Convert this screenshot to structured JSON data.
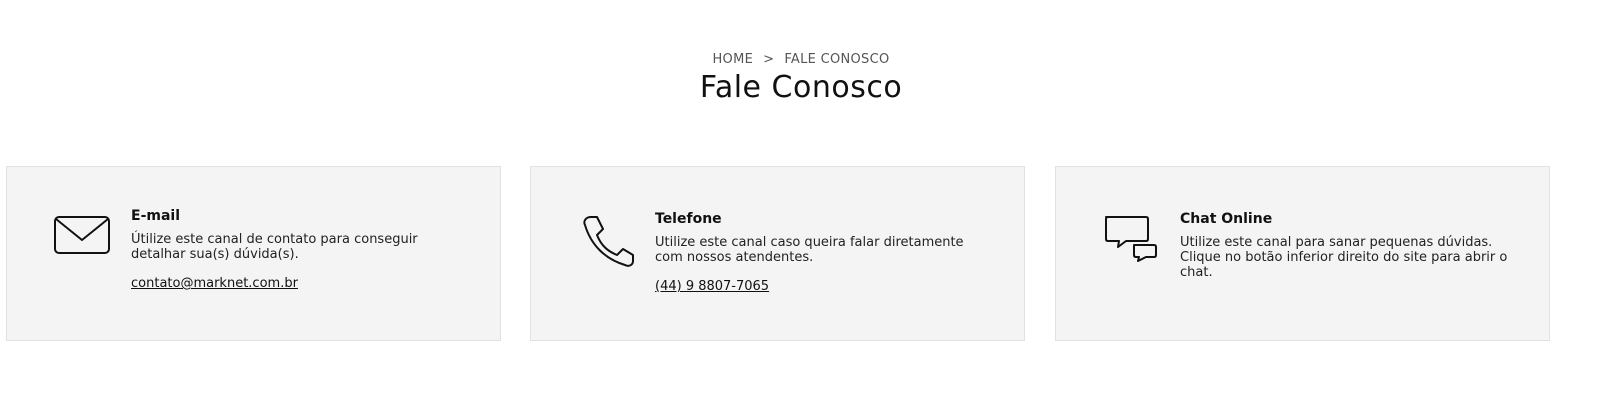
{
  "breadcrumb": {
    "home": "HOME",
    "separator": ">",
    "current": "FALE CONOSCO"
  },
  "page": {
    "title": "Fale Conosco"
  },
  "cards": [
    {
      "icon": "envelope-icon",
      "title": "E-mail",
      "text": "Útilize este canal de contato para conseguir detalhar sua(s) dúvida(s).",
      "link": "contato@marknet.com.br"
    },
    {
      "icon": "phone-icon",
      "title": "Telefone",
      "text": "Utilize este canal caso queira falar diretamente com nossos atendentes.",
      "link": "(44) 9 8807-7065"
    },
    {
      "icon": "chat-bubbles-icon",
      "title": "Chat Online",
      "text": "Utilize este canal para sanar pequenas dúvidas. Clique no botão inferior direito do site para abrir o chat."
    }
  ],
  "colors": {
    "card_background": "#f4f4f4",
    "card_border": "#e2e2e2",
    "text": "#111111",
    "breadcrumb": "#555555"
  }
}
